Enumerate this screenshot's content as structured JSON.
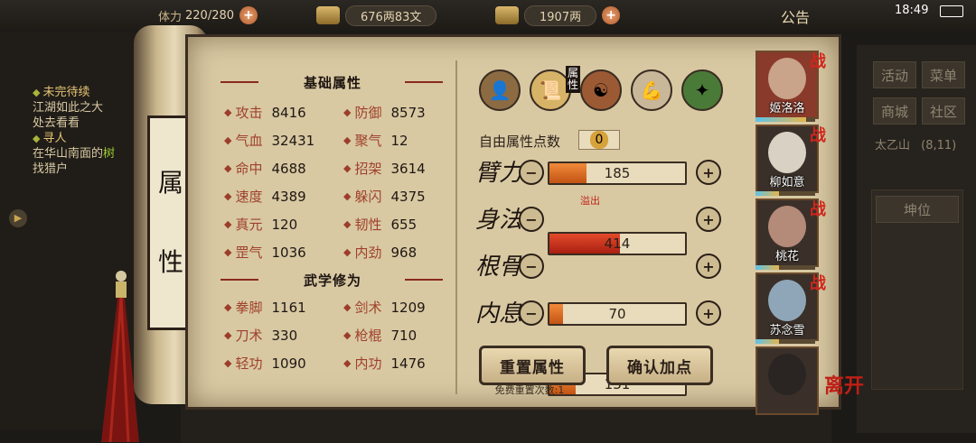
{
  "topbar": {
    "stamina_label": "体力",
    "stamina_value": "220/280",
    "money": "676两83文",
    "gold": "1907两",
    "notice": "公告",
    "time": "18:49"
  },
  "quest": {
    "heading1": "未完待续",
    "line1": "江湖如此之大",
    "line2": "处去看看",
    "heading2": "寻人",
    "line3a": "在华山南面的",
    "line3b": "树",
    "line4": "找猎户"
  },
  "scroll_title": [
    "属",
    "性"
  ],
  "basic": {
    "heading": "基础属性",
    "stats": [
      {
        "label": "攻击",
        "value": "8416"
      },
      {
        "label": "防御",
        "value": "8573"
      },
      {
        "label": "气血",
        "value": "32431"
      },
      {
        "label": "聚气",
        "value": "12"
      },
      {
        "label": "命中",
        "value": "4688"
      },
      {
        "label": "招架",
        "value": "3614"
      },
      {
        "label": "速度",
        "value": "4389"
      },
      {
        "label": "躲闪",
        "value": "4375"
      },
      {
        "label": "真元",
        "value": "120"
      },
      {
        "label": "韧性",
        "value": "655"
      },
      {
        "label": "罡气",
        "value": "1036"
      },
      {
        "label": "内劲",
        "value": "968"
      }
    ]
  },
  "martial": {
    "heading": "武学修为",
    "stats": [
      {
        "label": "拳脚",
        "value": "1161"
      },
      {
        "label": "剑术",
        "value": "1209"
      },
      {
        "label": "刀术",
        "value": "330"
      },
      {
        "label": "枪棍",
        "value": "710"
      },
      {
        "label": "轻功",
        "value": "1090"
      },
      {
        "label": "内功",
        "value": "1476"
      }
    ]
  },
  "tabs": {
    "active_label": "属性",
    "icons": [
      "character-icon",
      "attribute-scroll-icon",
      "taiji-icon",
      "muscle-icon",
      "jade-disc-icon"
    ]
  },
  "free_points": {
    "label": "自由属性点数",
    "value": "0"
  },
  "attributes": [
    {
      "name": "臂力",
      "value": "185",
      "fill": 0.27,
      "overflow": false
    },
    {
      "name": "身法",
      "value": "414",
      "fill": 0.52,
      "overflow": true,
      "tag": "溢出"
    },
    {
      "name": "根骨",
      "value": "70",
      "fill": 0.1,
      "overflow": false
    },
    {
      "name": "内息",
      "value": "131",
      "fill": 0.19,
      "overflow": false
    }
  ],
  "buttons": {
    "reset": "重置属性",
    "confirm": "确认加点",
    "free_reset": "免费重置次数:1"
  },
  "party": [
    {
      "name": "姬洛洛",
      "tag": "战",
      "level": 0.85
    },
    {
      "name": "柳如意",
      "tag": "战",
      "level": 0.4
    },
    {
      "name": "桃花",
      "tag": "战",
      "level": 0.4
    },
    {
      "name": "苏念雪",
      "tag": "战",
      "level": 0.4
    },
    {
      "name": "",
      "tag": "",
      "level": 0
    }
  ],
  "leave": "离开",
  "right_menu": {
    "items": [
      "活动",
      "菜单",
      "商城",
      "社区"
    ],
    "location": "太乙山",
    "coords": "(8,11)",
    "position_btn": "坤位"
  },
  "colors": {
    "accent": "#a0412c",
    "bar": "#e0772a",
    "overflow": "#c9271a"
  }
}
